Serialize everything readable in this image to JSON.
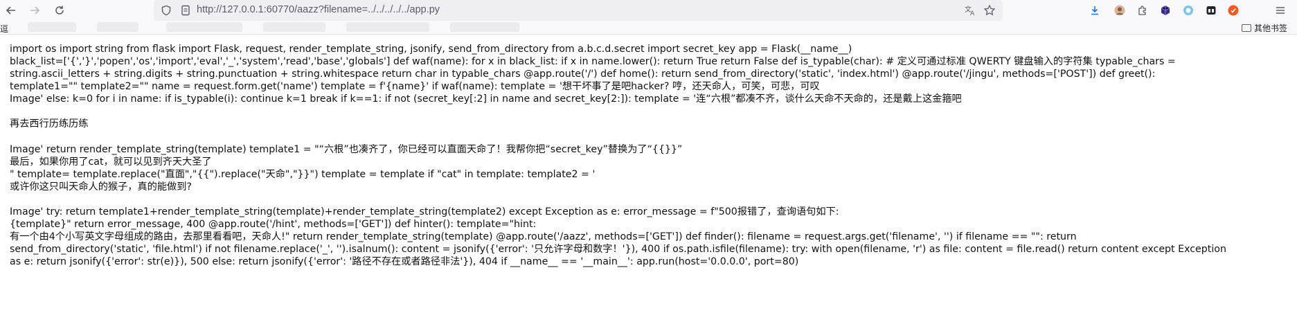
{
  "browser": {
    "url": "http://127.0.0.1:60770/aazz?filename=../../../../../app.py",
    "bookmarks_left": "逗",
    "bookmarks_other": "其他书签"
  },
  "page": {
    "lines": [
      "import os import string from flask import Flask, request, render_template_string, jsonify, send_from_directory from a.b.c.d.secret import secret_key app = Flask(__name__)",
      "black_list=['{','}','popen','os','import','eval','_','system','read','base','globals'] def waf(name): for x in black_list: if x in name.lower(): return True return False def is_typable(char): # 定义可通过标准 QWERTY 键盘输入的字符集 typable_chars =",
      "string.ascii_letters + string.digits + string.punctuation + string.whitespace return char in typable_chars @app.route('/') def home(): return send_from_directory('static', 'index.html') @app.route('/jingu', methods=['POST']) def greet():",
      "template1=\"\" template2=\"\" name = request.form.get('name') template = f'{name}' if waf(name): template = '想干坏事了是吧hacker? 哼，还天命人，可笑，可悲，可叹",
      "Image' else: k=0 for i in name: if is_typable(i): continue k=1 break if k==1: if not (secret_key[:2] in name and secret_key[2:]): template = '连“六根”都凑不齐，谈什么天命不天命的，还是戴上这金箍吧",
      "",
      "再去西行历练历练",
      "",
      "Image' return render_template_string(template) template1 = \"“六根”也凑齐了，你已经可以直面天命了！我帮你把“secret_key”替换为了“{{}}”",
      "最后，如果你用了cat，就可以见到齐天大圣了",
      "\" template= template.replace(\"直面\",\"{{\").replace(\"天命\",\"}}\") template = template if \"cat\" in template: template2 = '",
      "或许你这只叫天命人的猴子，真的能做到?",
      "",
      "Image' try: return template1+render_template_string(template)+render_template_string(template2) except Exception as e: error_message = f\"500报错了，查询语句如下:",
      "{template}\" return error_message, 400 @app.route('/hint', methods=['GET']) def hinter(): template=\"hint:",
      "有一个由4个小写英文字母组成的路由，去那里看看吧，天命人!\" return render_template_string(template) @app.route('/aazz', methods=['GET']) def finder(): filename = request.args.get('filename', '') if filename == \"\": return",
      "send_from_directory('static', 'file.html') if not filename.replace('_', '').isalnum(): content = jsonify({'error': '只允许字母和数字！'}), 400 if os.path.isfile(filename): try: with open(filename, 'r') as file: content = file.read() return content except Exception",
      "as e: return jsonify({'error': str(e)}), 500 else: return jsonify({'error': '路径不存在或者路径非法'}), 404 if __name__ == '__main__': app.run(host='0.0.0.0', port=80)"
    ]
  }
}
